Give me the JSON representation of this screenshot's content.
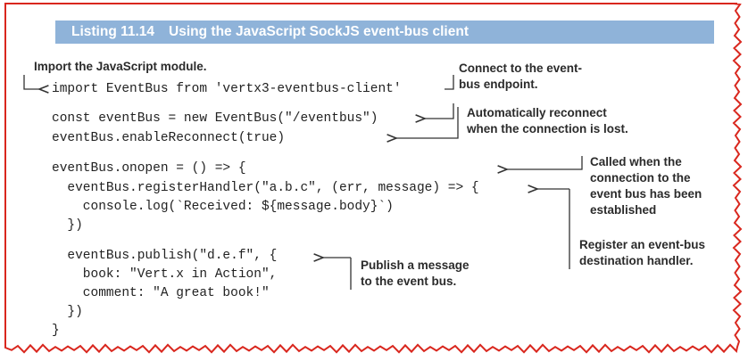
{
  "listing": {
    "number": "Listing 11.14",
    "title": "Using the JavaScript SockJS event-bus client"
  },
  "code_lines": [
    "import EventBus from 'vertx3-eventbus-client'",
    "const eventBus = new EventBus(\"/eventbus\")",
    "eventBus.enableReconnect(true)",
    "eventBus.onopen = () => {",
    "  eventBus.registerHandler(\"a.b.c\", (err, message) => {",
    "    console.log(`Received: ${message.body}`)",
    "  })",
    "  eventBus.publish(\"d.e.f\", {",
    "    book: \"Vert.x in Action\",",
    "    comment: \"A great book!\"",
    "  })",
    "}"
  ],
  "annotations": {
    "import_module": "Import the JavaScript module.",
    "connect_endpoint": "Connect to the event-\nbus endpoint.",
    "auto_reconnect": "Automatically reconnect\nwhen the connection is lost.",
    "called_when_connected": "Called when the\nconnection to the\nevent bus has been\nestablished",
    "register_handler": "Register an event-bus\ndestination handler.",
    "publish_message": "Publish a message\nto the event bus."
  },
  "colors": {
    "frame_red": "#d9271e",
    "header_bg": "#8fb3d9",
    "header_text": "#ffffff",
    "code_text": "#222222",
    "annotation_line": "#333333"
  }
}
